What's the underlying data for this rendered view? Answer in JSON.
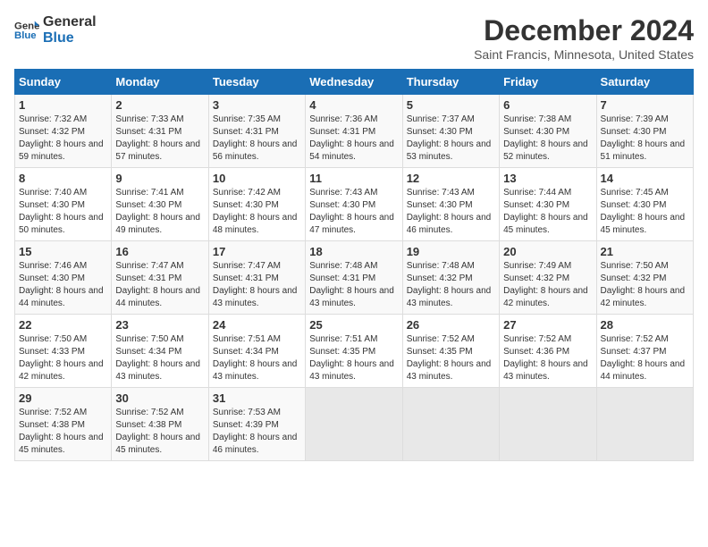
{
  "logo": {
    "line1": "General",
    "line2": "Blue"
  },
  "title": "December 2024",
  "location": "Saint Francis, Minnesota, United States",
  "days_header": [
    "Sunday",
    "Monday",
    "Tuesday",
    "Wednesday",
    "Thursday",
    "Friday",
    "Saturday"
  ],
  "weeks": [
    [
      {
        "day": "1",
        "sunrise": "7:32 AM",
        "sunset": "4:32 PM",
        "daylight": "8 hours and 59 minutes."
      },
      {
        "day": "2",
        "sunrise": "7:33 AM",
        "sunset": "4:31 PM",
        "daylight": "8 hours and 57 minutes."
      },
      {
        "day": "3",
        "sunrise": "7:35 AM",
        "sunset": "4:31 PM",
        "daylight": "8 hours and 56 minutes."
      },
      {
        "day": "4",
        "sunrise": "7:36 AM",
        "sunset": "4:31 PM",
        "daylight": "8 hours and 54 minutes."
      },
      {
        "day": "5",
        "sunrise": "7:37 AM",
        "sunset": "4:30 PM",
        "daylight": "8 hours and 53 minutes."
      },
      {
        "day": "6",
        "sunrise": "7:38 AM",
        "sunset": "4:30 PM",
        "daylight": "8 hours and 52 minutes."
      },
      {
        "day": "7",
        "sunrise": "7:39 AM",
        "sunset": "4:30 PM",
        "daylight": "8 hours and 51 minutes."
      }
    ],
    [
      {
        "day": "8",
        "sunrise": "7:40 AM",
        "sunset": "4:30 PM",
        "daylight": "8 hours and 50 minutes."
      },
      {
        "day": "9",
        "sunrise": "7:41 AM",
        "sunset": "4:30 PM",
        "daylight": "8 hours and 49 minutes."
      },
      {
        "day": "10",
        "sunrise": "7:42 AM",
        "sunset": "4:30 PM",
        "daylight": "8 hours and 48 minutes."
      },
      {
        "day": "11",
        "sunrise": "7:43 AM",
        "sunset": "4:30 PM",
        "daylight": "8 hours and 47 minutes."
      },
      {
        "day": "12",
        "sunrise": "7:43 AM",
        "sunset": "4:30 PM",
        "daylight": "8 hours and 46 minutes."
      },
      {
        "day": "13",
        "sunrise": "7:44 AM",
        "sunset": "4:30 PM",
        "daylight": "8 hours and 45 minutes."
      },
      {
        "day": "14",
        "sunrise": "7:45 AM",
        "sunset": "4:30 PM",
        "daylight": "8 hours and 45 minutes."
      }
    ],
    [
      {
        "day": "15",
        "sunrise": "7:46 AM",
        "sunset": "4:30 PM",
        "daylight": "8 hours and 44 minutes."
      },
      {
        "day": "16",
        "sunrise": "7:47 AM",
        "sunset": "4:31 PM",
        "daylight": "8 hours and 44 minutes."
      },
      {
        "day": "17",
        "sunrise": "7:47 AM",
        "sunset": "4:31 PM",
        "daylight": "8 hours and 43 minutes."
      },
      {
        "day": "18",
        "sunrise": "7:48 AM",
        "sunset": "4:31 PM",
        "daylight": "8 hours and 43 minutes."
      },
      {
        "day": "19",
        "sunrise": "7:48 AM",
        "sunset": "4:32 PM",
        "daylight": "8 hours and 43 minutes."
      },
      {
        "day": "20",
        "sunrise": "7:49 AM",
        "sunset": "4:32 PM",
        "daylight": "8 hours and 42 minutes."
      },
      {
        "day": "21",
        "sunrise": "7:50 AM",
        "sunset": "4:32 PM",
        "daylight": "8 hours and 42 minutes."
      }
    ],
    [
      {
        "day": "22",
        "sunrise": "7:50 AM",
        "sunset": "4:33 PM",
        "daylight": "8 hours and 42 minutes."
      },
      {
        "day": "23",
        "sunrise": "7:50 AM",
        "sunset": "4:34 PM",
        "daylight": "8 hours and 43 minutes."
      },
      {
        "day": "24",
        "sunrise": "7:51 AM",
        "sunset": "4:34 PM",
        "daylight": "8 hours and 43 minutes."
      },
      {
        "day": "25",
        "sunrise": "7:51 AM",
        "sunset": "4:35 PM",
        "daylight": "8 hours and 43 minutes."
      },
      {
        "day": "26",
        "sunrise": "7:52 AM",
        "sunset": "4:35 PM",
        "daylight": "8 hours and 43 minutes."
      },
      {
        "day": "27",
        "sunrise": "7:52 AM",
        "sunset": "4:36 PM",
        "daylight": "8 hours and 43 minutes."
      },
      {
        "day": "28",
        "sunrise": "7:52 AM",
        "sunset": "4:37 PM",
        "daylight": "8 hours and 44 minutes."
      }
    ],
    [
      {
        "day": "29",
        "sunrise": "7:52 AM",
        "sunset": "4:38 PM",
        "daylight": "8 hours and 45 minutes."
      },
      {
        "day": "30",
        "sunrise": "7:52 AM",
        "sunset": "4:38 PM",
        "daylight": "8 hours and 45 minutes."
      },
      {
        "day": "31",
        "sunrise": "7:53 AM",
        "sunset": "4:39 PM",
        "daylight": "8 hours and 46 minutes."
      },
      null,
      null,
      null,
      null
    ]
  ],
  "labels": {
    "sunrise": "Sunrise:",
    "sunset": "Sunset:",
    "daylight": "Daylight:"
  }
}
